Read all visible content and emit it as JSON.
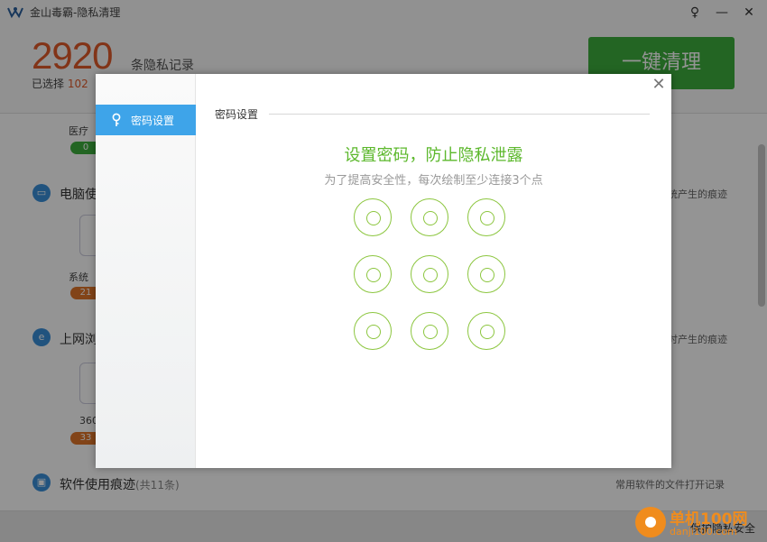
{
  "app": {
    "title": "金山毒霸-隐私清理",
    "record_count": "2920",
    "record_label": "条隐私记录",
    "selected_prefix": "已选择",
    "selected_count": "102",
    "one_click_label": "一键清理",
    "sections": [
      {
        "title": "电脑使",
        "right": "统产生的痕迹",
        "item_label": "系统",
        "badge": "21"
      },
      {
        "title": "上网浏",
        "right": "时产生的痕迹",
        "item_label": "360",
        "badge": "33"
      },
      {
        "title": "软件使用痕迹",
        "sub": "(共11条)",
        "right": "常用软件的文件打开记录"
      }
    ],
    "medical_label": "医疗",
    "medical_badge": "0",
    "footer_text": "保护隐私安全"
  },
  "dialog": {
    "tab_label": "密码设置",
    "section_header": "密码设置",
    "title": "设置密码，防止隐私泄露",
    "hint": "为了提高安全性，每次绘制至少连接3个点",
    "close_symbol": "✕",
    "dot_color": "#8cc63f"
  },
  "watermark": {
    "line1": "单机100网",
    "line2": "danji100.com"
  },
  "colors": {
    "accent_blue": "#3ea4e9",
    "accent_green": "#5cb82c",
    "count_orange": "#e05a2a",
    "button_green": "#3dae3d"
  }
}
